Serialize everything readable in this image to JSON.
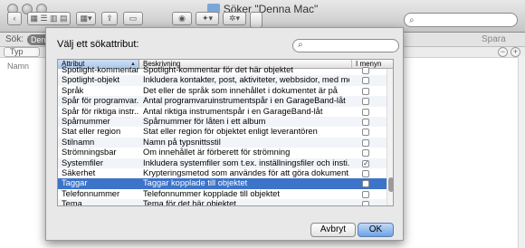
{
  "window": {
    "title": "Söker \"Denna Mac\"",
    "search_bar_label": "Sök:",
    "scope_pill": "Denna",
    "save_label": "Spara",
    "type_popup": "Typ",
    "column_name": "Namn"
  },
  "dialog": {
    "title": "Välj ett sökattribut:",
    "search_placeholder": "",
    "columns": {
      "attribute": "Attribut",
      "description": "Beskrivning",
      "in_menu": "I menyn"
    },
    "rows": [
      {
        "attribute": "Spotlight-kommentar",
        "description": "Spotlight-kommentar för det här objektet",
        "in_menu": false
      },
      {
        "attribute": "Spotlight-objekt",
        "description": "Inkludera kontakter, post, aktiviteter, webbsidor, med mera",
        "in_menu": false
      },
      {
        "attribute": "Språk",
        "description": "Det eller de språk som innehållet i dokumentet är på",
        "in_menu": false
      },
      {
        "attribute": "Spår för programvar...",
        "description": "Antal programvaruinstrumentspår i en GarageBand-låt",
        "in_menu": false
      },
      {
        "attribute": "Spår för riktiga instr...",
        "description": "Antal riktiga instrumentspår i en GarageBand-låt",
        "in_menu": false
      },
      {
        "attribute": "Spårnummer",
        "description": "Spårnummer för låten i ett album",
        "in_menu": false
      },
      {
        "attribute": "Stat eller region",
        "description": "Stat eller region för objektet enligt leverantören",
        "in_menu": false
      },
      {
        "attribute": "Stilnamn",
        "description": "Namn på typsnittsstil",
        "in_menu": false
      },
      {
        "attribute": "Strömningsbar",
        "description": "Om innehållet är förberett för strömning",
        "in_menu": false
      },
      {
        "attribute": "Systemfiler",
        "description": "Inkludera systemfiler som t.ex. inställningsfiler och insti...",
        "in_menu": true
      },
      {
        "attribute": "Säkerhet",
        "description": "Krypteringsmetod som användes för att göra dokument...",
        "in_menu": false
      },
      {
        "attribute": "Taggar",
        "description": "Taggar kopplade till objektet",
        "in_menu": false,
        "selected": true
      },
      {
        "attribute": "Telefonnummer",
        "description": "Telefonnummer kopplade till objektet",
        "in_menu": false
      },
      {
        "attribute": "Tema",
        "description": "Tema för det här objektet",
        "in_menu": false
      }
    ],
    "cancel_label": "Avbryt",
    "ok_label": "OK"
  },
  "colors": {
    "selection": "#3d73c8",
    "ok_button": "#6ea2e4"
  }
}
